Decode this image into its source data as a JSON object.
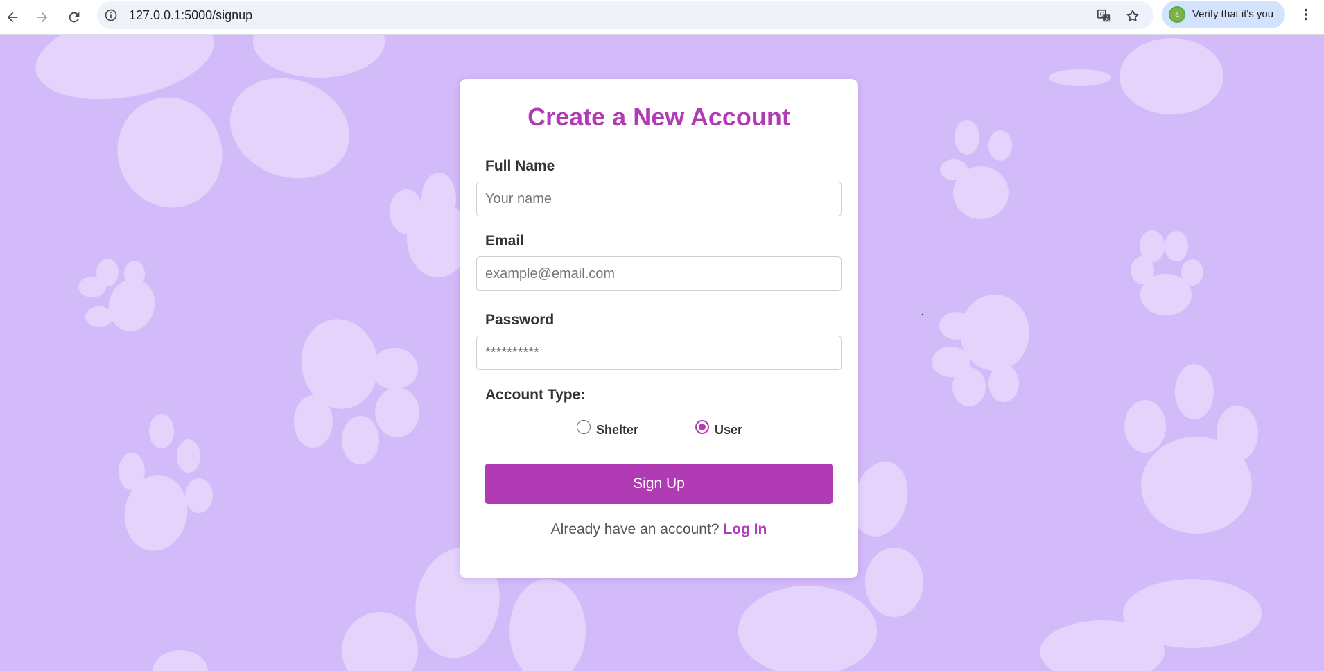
{
  "browser": {
    "url": "127.0.0.1:5000/signup",
    "profile_chip_label": "Verify that it's you",
    "icons": [
      "back-arrow-icon",
      "forward-arrow-icon",
      "reload-icon",
      "site-info-icon",
      "translate-icon",
      "bookmark-star-icon",
      "profile-avatar-icon",
      "more-menu-icon"
    ]
  },
  "form": {
    "title": "Create a New Account",
    "full_name": {
      "label": "Full Name",
      "placeholder": "Your name",
      "value": ""
    },
    "email": {
      "label": "Email",
      "placeholder": "example@email.com",
      "value": ""
    },
    "password": {
      "label": "Password",
      "placeholder": "**********",
      "value": ""
    },
    "account_type": {
      "label": "Account Type:",
      "options": [
        {
          "label": "Shelter",
          "checked": false
        },
        {
          "label": "User",
          "checked": true
        }
      ]
    },
    "submit_label": "Sign Up",
    "login_prompt": "Already have an account?",
    "login_link": "Log In"
  },
  "colors": {
    "background": "#d3baf9",
    "paw_pattern": "#e4d3fb",
    "accent": "#b13bb5",
    "card": "#ffffff"
  }
}
